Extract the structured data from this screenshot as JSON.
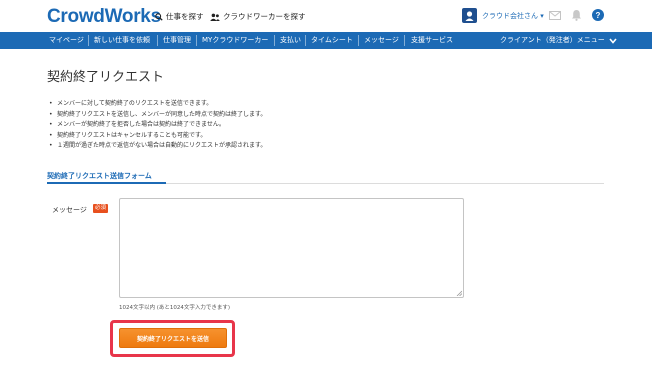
{
  "header": {
    "logo": "CrowdWorks",
    "links": [
      {
        "label": "仕事を探す",
        "icon": "search-icon"
      },
      {
        "label": "クラウドワーカーを探す",
        "icon": "users-icon"
      }
    ],
    "company": "クラウド会社さん ▾",
    "icons": [
      "mail-icon",
      "bell-icon",
      "help-icon"
    ]
  },
  "nav": {
    "items": [
      "マイページ",
      "新しい仕事を依頼",
      "仕事管理",
      "MYクラウドワーカー",
      "支払い",
      "タイムシート",
      "メッセージ",
      "支援サービス"
    ],
    "right": "クライアント（発注者）メニュー"
  },
  "page": {
    "title": "契約終了リクエスト",
    "notes": [
      "メンバーに対して契約終了のリクエストを送信できます。",
      "契約終了リクエストを送信し、メンバーが同意した時点で契約は終了します。",
      "メンバーが契約終了を拒否した場合は契約は終了できません。",
      "契約終了リクエストはキャンセルすることも可能です。",
      "１週間が過ぎた時点で返信がない場合は自動的にリクエストが承認されます。"
    ],
    "form": {
      "section_title": "契約終了リクエスト送信フォーム",
      "message_label": "メッセージ",
      "required_badge": "必須",
      "message_value": "",
      "char_note": "1024文字以内 (あと1024文字入力できます)",
      "submit_label": "契約終了リクエストを送信"
    }
  },
  "colors": {
    "brand": "#1c6ab5",
    "accent_orange": "#ee7a0f",
    "required_red": "#e8501e",
    "highlight_red": "#e8354a"
  }
}
